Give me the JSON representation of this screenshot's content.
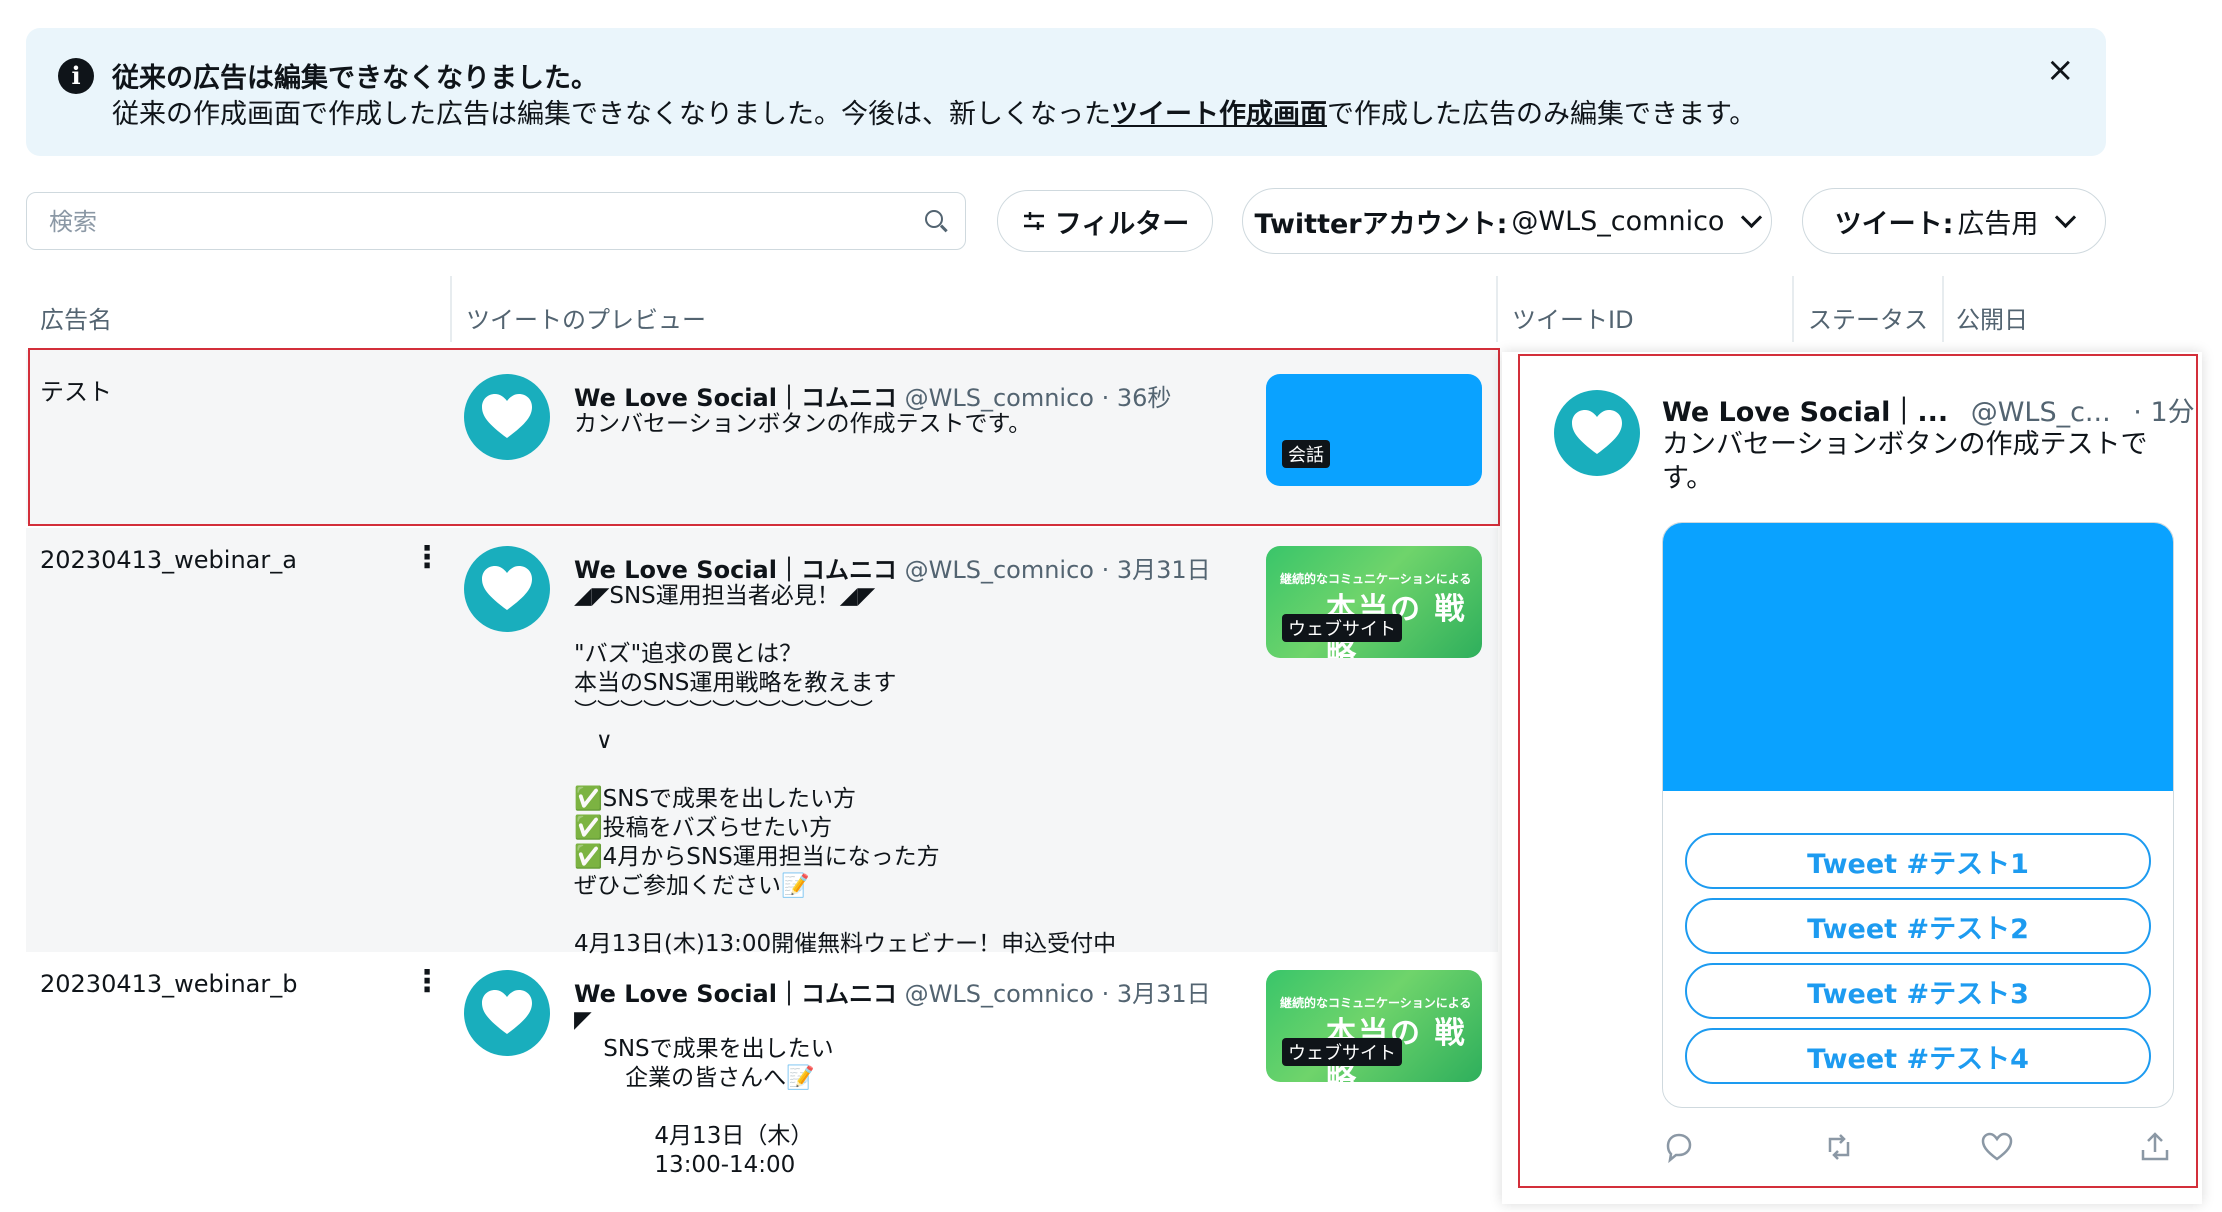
{
  "notice": {
    "title": "従来の広告は編集できなくなりました。",
    "body_before": "従来の作成画面で作成した広告は編集できなくなりました。今後は、新しくなった",
    "link": "ツイート作成画面",
    "body_after": "で作成した広告のみ編集できます。",
    "close": "×"
  },
  "toolbar": {
    "search_placeholder": "検索",
    "filter_label": "フィルター",
    "account_label": "Twitterアカウント:",
    "account_value": "@WLS_comnico",
    "tweet_label": "ツイート:",
    "tweet_value": "広告用"
  },
  "table": {
    "headers": [
      "広告名",
      "ツイートのプレビュー",
      "ツイートID",
      "ステータス",
      "公開日"
    ],
    "rows": [
      {
        "name": "テスト",
        "author": "We Love Social｜コムニコ",
        "handle": "@WLS_comnico",
        "time": "· 36秒",
        "text": "カンバセーションボタンの作成テストです。",
        "badge": "会話"
      },
      {
        "name": "20230413_webinar_a",
        "author": "We Love Social｜コムニコ",
        "handle": "@WLS_comnico",
        "time": "· 3月31日",
        "text": "◢◤SNS運用担当者必見！◢◤\n\n\"バズ\"追求の罠とは？\n本当のSNS運用戦略を教えます\n︶︶︶︶︶︶︶︶︶︶︶︶︶\n   ∨\n\n✅SNSで成果を出したい方\n✅投稿をバズらせたい方\n✅4月からSNS運用担当になった方\nぜひご参加ください📝\n\n4月13日(木)13:00開催無料ウェビナー！申込受付中",
        "badge": "ウェブサイト",
        "media_top": "継続的なコミュニケーションによる",
        "media_big": "本当の 戦略"
      },
      {
        "name": "20230413_webinar_b",
        "author": "We Love Social｜コムニコ",
        "handle": "@WLS_comnico",
        "time": "· 3月31日",
        "text": "◤\n    SNSで成果を出したい\n       企業の皆さんへ📝\n\n           4月13日（木）\n           13:00-14:00",
        "badge": "ウェブサイト",
        "media_top": "継続的なコミュニケーションによる",
        "media_big": "本当の 戦略"
      }
    ]
  },
  "preview": {
    "author": "We Love Social｜...",
    "handle": "@WLS_c...",
    "time": "· 1分",
    "text": "カンバセーションボタンの作成テストです。",
    "buttons": [
      "Tweet #テスト1",
      "Tweet #テスト2",
      "Tweet #テスト3",
      "Tweet #テスト4"
    ]
  },
  "colors": {
    "accent": "#1d9bf0",
    "highlight": "#d32f3a",
    "avatar": "#19aebd",
    "media_blue": "#0aa2ff"
  }
}
